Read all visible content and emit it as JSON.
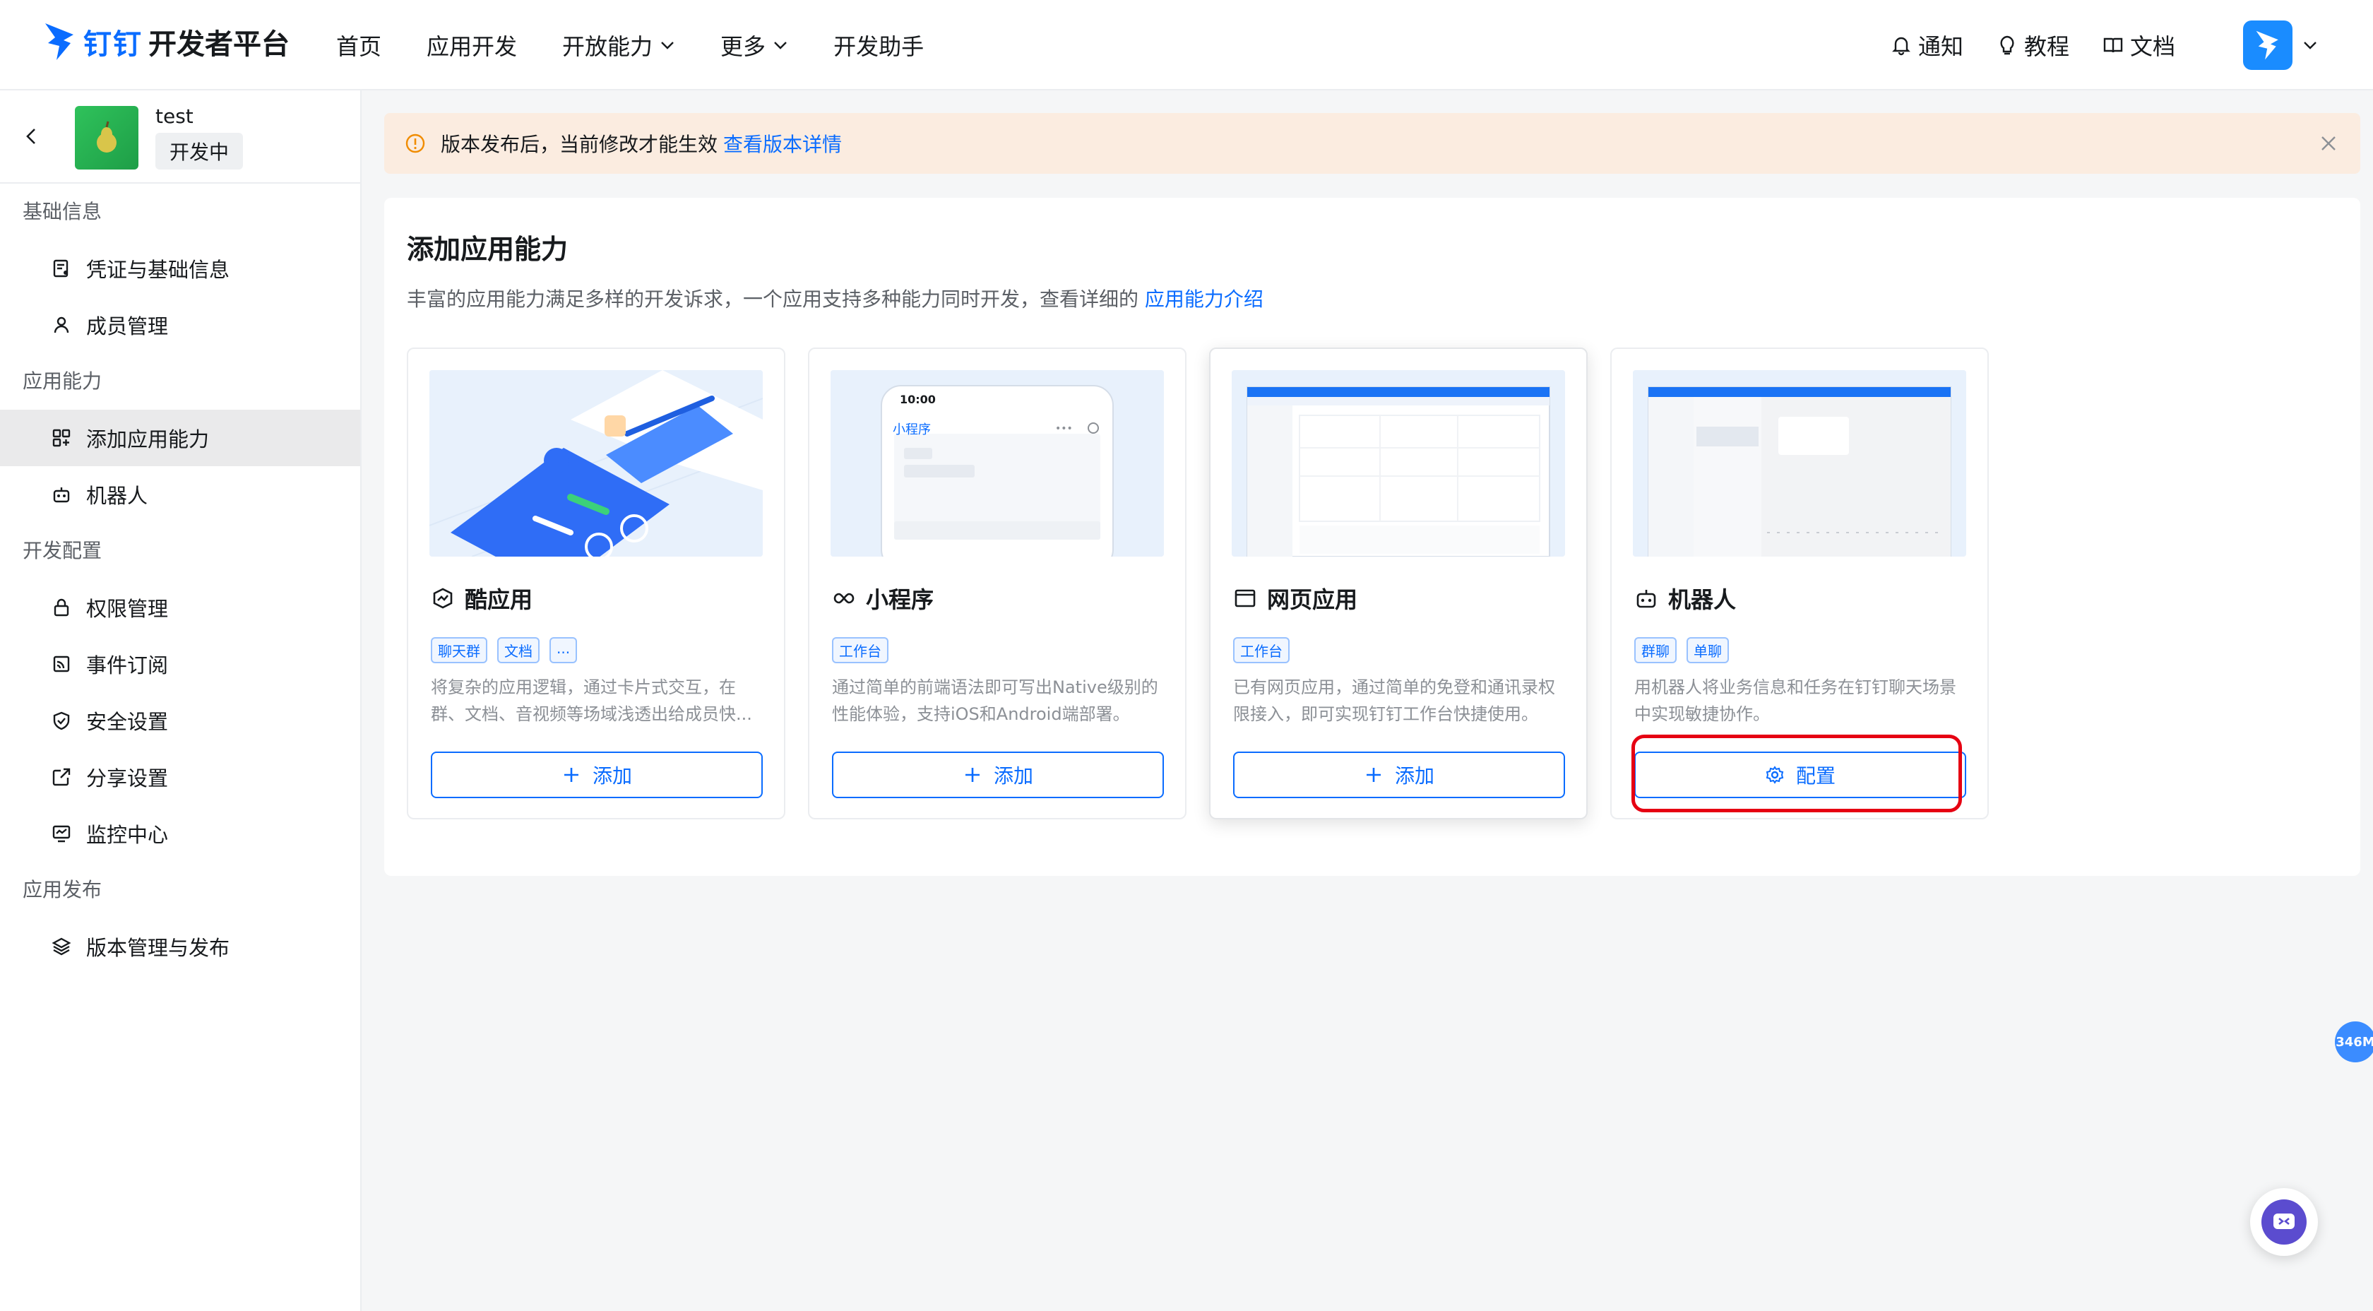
{
  "brand": {
    "logo_text": "钉钉",
    "subtitle": "开发者平台"
  },
  "nav": [
    {
      "label": "首页",
      "dropdown": false
    },
    {
      "label": "应用开发",
      "dropdown": false
    },
    {
      "label": "开放能力",
      "dropdown": true
    },
    {
      "label": "更多",
      "dropdown": true
    },
    {
      "label": "开发助手",
      "dropdown": false
    }
  ],
  "top_right": {
    "notify": "通知",
    "tutorial": "教程",
    "docs": "文档"
  },
  "app": {
    "name": "test",
    "status": "开发中"
  },
  "sidebar": {
    "sections": [
      {
        "title": "基础信息",
        "items": [
          {
            "label": "凭证与基础信息",
            "icon": "credential-icon"
          },
          {
            "label": "成员管理",
            "icon": "user-icon"
          }
        ]
      },
      {
        "title": "应用能力",
        "items": [
          {
            "label": "添加应用能力",
            "icon": "apps-icon",
            "active": true
          },
          {
            "label": "机器人",
            "icon": "robot-icon"
          }
        ]
      },
      {
        "title": "开发配置",
        "items": [
          {
            "label": "权限管理",
            "icon": "lock-icon"
          },
          {
            "label": "事件订阅",
            "icon": "event-icon"
          },
          {
            "label": "安全设置",
            "icon": "shield-icon"
          },
          {
            "label": "分享设置",
            "icon": "share-icon"
          },
          {
            "label": "监控中心",
            "icon": "monitor-icon"
          }
        ]
      },
      {
        "title": "应用发布",
        "items": [
          {
            "label": "版本管理与发布",
            "icon": "layers-icon"
          }
        ]
      }
    ]
  },
  "banner": {
    "text": "版本发布后，当前修改才能生效",
    "link": "查看版本详情"
  },
  "panel": {
    "title": "添加应用能力",
    "desc": "丰富的应用能力满足多样的开发诉求，一个应用支持多种能力同时开发，查看详细的",
    "desc_link": "应用能力介绍"
  },
  "cards": [
    {
      "title": "酷应用",
      "tags": [
        "聊天群",
        "文档",
        "..."
      ],
      "desc": "将复杂的应用逻辑，通过卡片式交互，在群、文档、音视频等场域浅透出给成员快...",
      "button": "添加",
      "button_icon": "plus-icon"
    },
    {
      "title": "小程序",
      "tags": [
        "工作台"
      ],
      "desc": "通过简单的前端语法即可写出Native级别的性能体验，支持iOS和Android端部署。",
      "button": "添加",
      "button_icon": "plus-icon"
    },
    {
      "title": "网页应用",
      "tags": [
        "工作台"
      ],
      "desc": "已有网页应用，通过简单的免登和通讯录权限接入，即可实现钉钉工作台快捷使用。",
      "button": "添加",
      "button_icon": "plus-icon"
    },
    {
      "title": "机器人",
      "tags": [
        "群聊",
        "单聊"
      ],
      "desc": "用机器人将业务信息和任务在钉钉聊天场景中实现敏捷协作。",
      "button": "配置",
      "button_icon": "gear-icon"
    }
  ],
  "thumb_text": {
    "mini_time": "10:00",
    "mini_title": "小程序"
  },
  "mem_badge": "346M",
  "colors": {
    "primary": "#0a6cff",
    "banner_bg": "#fbece0",
    "highlight": "#e60012"
  }
}
